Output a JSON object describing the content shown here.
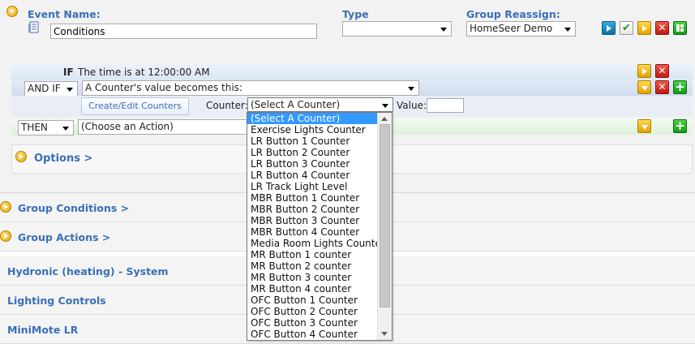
{
  "event": {
    "name_label": "Event Name:",
    "name_value": "Conditions",
    "type_label": "Type",
    "type_value": "",
    "group_label": "Group Reassign:",
    "group_value": "HomeSeer Demo"
  },
  "condition": {
    "if_keyword": "IF",
    "if_text": "The time is at 12:00:00 AM",
    "andif_value": "AND IF",
    "andif_trigger": "A Counter's value becomes this:",
    "create_button": "Create/Edit Counters",
    "counter_label": "Counter:",
    "counter_selected": "(Select A Counter)",
    "value_label": "Value:",
    "value_input": "",
    "then_value": "THEN",
    "action_value": "(Choose an Action)"
  },
  "options_label": "Options >",
  "groups": [
    {
      "label": "Group Conditions >"
    },
    {
      "label": "Group Actions >"
    }
  ],
  "sections": [
    {
      "label": "Hydronic (heating) - System"
    },
    {
      "label": "Lighting Controls"
    },
    {
      "label": "MiniMote LR"
    }
  ],
  "counter_options": [
    "(Select A Counter)",
    "Exercise Lights Counter",
    "LR Button 1 Counter",
    "LR Button 2 Counter",
    "LR Button 3 Counter",
    "LR Button 4 Counter",
    "LR Track Light Level",
    "MBR Button 1 Counter",
    "MBR Button 2 Counter",
    "MBR Button 3 Counter",
    "MBR Button 4 Counter",
    "Media Room Lights Counter",
    "MR Button 1 counter",
    "MR Button 2 counter",
    "MR Button 3 counter",
    "MR Button 4 counter",
    "OFC Button 1 Counter",
    "OFC Button 2 Counter",
    "OFC Button 3 Counter",
    "OFC Button 4 Counter"
  ]
}
